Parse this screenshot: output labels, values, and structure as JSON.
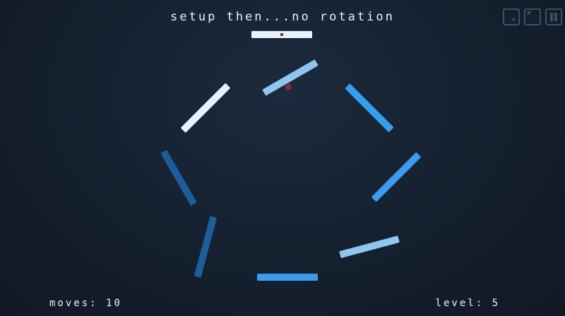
{
  "header": {
    "title": "setup then...no rotation"
  },
  "controls": [
    {
      "name": "restart-button",
      "icon": "restart-icon"
    },
    {
      "name": "undo-button",
      "icon": "undo-icon"
    },
    {
      "name": "pause-button",
      "icon": "pause-icon"
    }
  ],
  "hud": {
    "moves_label": "moves:",
    "moves_value": "10",
    "level_label": "level:",
    "level_value": "5"
  },
  "colors": {
    "background": "#15202f",
    "pale": "#e6f2fa",
    "light_blue": "#8fc6ef",
    "bright_blue": "#3a9cef",
    "dark_blue": "#1b5e9a",
    "marker": "#8b2b34",
    "control": "#3b5166"
  },
  "paddles": [
    {
      "id": "paddle-1",
      "color": "light_blue",
      "has_marker": true
    },
    {
      "id": "paddle-2",
      "color": "bright_blue",
      "has_marker": false
    },
    {
      "id": "paddle-3",
      "color": "bright_blue",
      "has_marker": false
    },
    {
      "id": "paddle-4",
      "color": "light_blue",
      "has_marker": false
    },
    {
      "id": "paddle-5",
      "color": "bright_blue",
      "has_marker": false
    },
    {
      "id": "paddle-6",
      "color": "dark_blue",
      "has_marker": false
    },
    {
      "id": "paddle-7",
      "color": "dark_blue",
      "has_marker": false
    },
    {
      "id": "paddle-8",
      "color": "pale",
      "has_marker": false
    }
  ]
}
